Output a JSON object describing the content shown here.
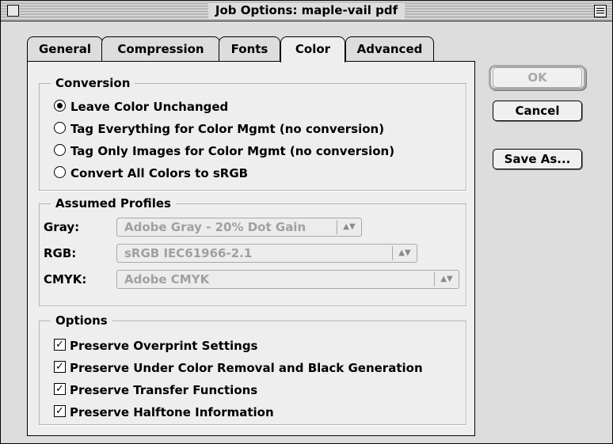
{
  "window": {
    "title": "Job Options: maple-vail pdf"
  },
  "tabs": [
    {
      "label": "General",
      "active": false
    },
    {
      "label": "Compression",
      "active": false
    },
    {
      "label": "Fonts",
      "active": false
    },
    {
      "label": "Color",
      "active": true
    },
    {
      "label": "Advanced",
      "active": false
    }
  ],
  "conversion": {
    "legend": "Conversion",
    "options": [
      {
        "label": "Leave Color Unchanged",
        "selected": true
      },
      {
        "label": "Tag Everything for Color Mgmt (no conversion)",
        "selected": false
      },
      {
        "label": "Tag Only Images for Color Mgmt (no conversion)",
        "selected": false
      },
      {
        "label": "Convert All Colors to sRGB",
        "selected": false
      }
    ]
  },
  "profiles": {
    "legend": "Assumed Profiles",
    "gray": {
      "label": "Gray:",
      "value": "Adobe Gray - 20% Dot Gain"
    },
    "rgb": {
      "label": "RGB:",
      "value": "sRGB IEC61966-2.1"
    },
    "cmyk": {
      "label": "CMYK:",
      "value": "Adobe CMYK"
    },
    "popup_arrow": "▲▼"
  },
  "options": {
    "legend": "Options",
    "items": [
      {
        "label": "Preserve Overprint Settings",
        "checked": true
      },
      {
        "label": "Preserve Under Color Removal and Black Generation",
        "checked": true
      },
      {
        "label": "Preserve Transfer Functions",
        "checked": true
      },
      {
        "label": "Preserve Halftone Information",
        "checked": true
      }
    ],
    "check_glyph": "✓"
  },
  "buttons": {
    "ok": "OK",
    "cancel": "Cancel",
    "save_as": "Save As..."
  },
  "colors": {
    "disabled_text": "#a0a0a0",
    "panel_bg": "#eeeeee",
    "window_bg": "#dddddd"
  }
}
